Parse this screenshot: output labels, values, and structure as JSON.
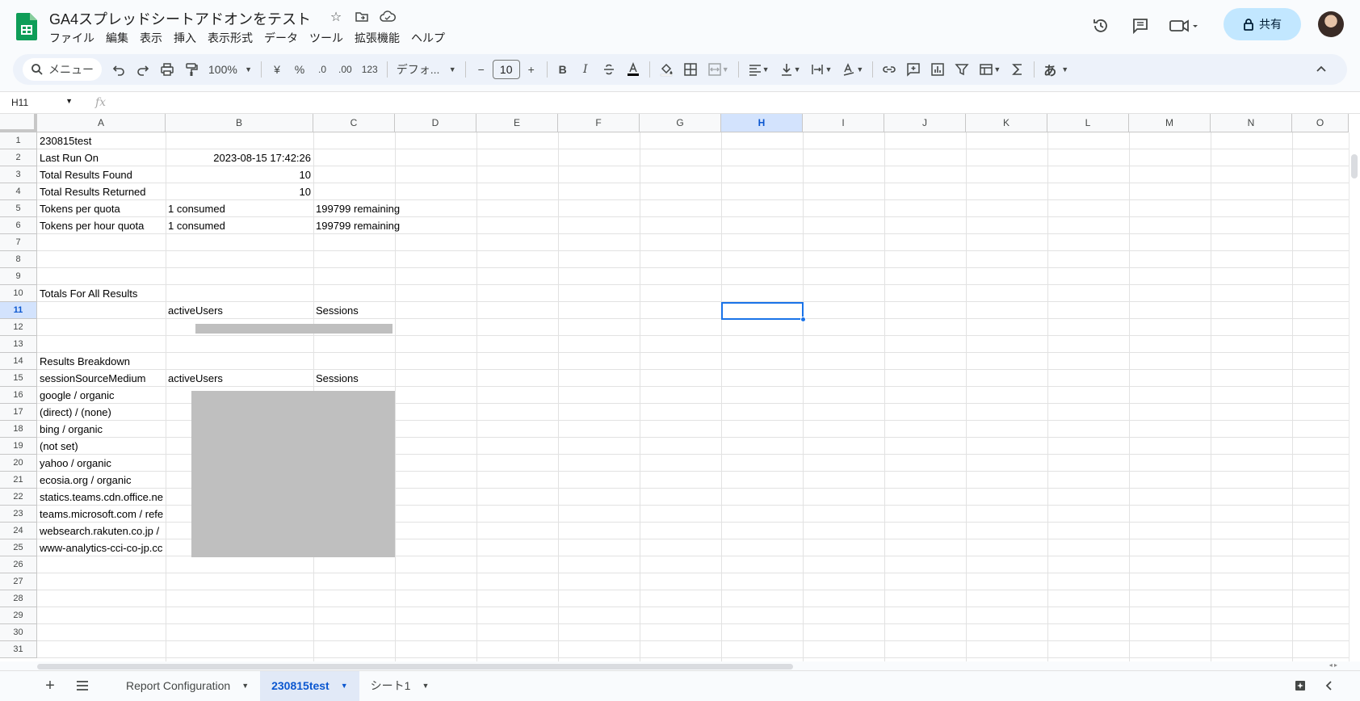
{
  "doc": {
    "title": "GA4スプレッドシートアドオンをテスト",
    "menu": [
      "ファイル",
      "編集",
      "表示",
      "挿入",
      "表示形式",
      "データ",
      "ツール",
      "拡張機能",
      "ヘルプ"
    ],
    "share_label": "共有"
  },
  "toolbar": {
    "search_label": "メニュー",
    "zoom": "100%",
    "currency": "¥",
    "percent": "%",
    "dec_decrease": ".0",
    "dec_increase": ".00",
    "format_123": "123",
    "font": "デフォ...",
    "font_size": "10",
    "bold": "B",
    "italic": "I",
    "input_mode": "あ"
  },
  "formula_bar": {
    "cell_ref": "H11",
    "fx": "fx",
    "value": ""
  },
  "grid": {
    "columns": [
      "A",
      "B",
      "C",
      "D",
      "E",
      "F",
      "G",
      "H",
      "I",
      "J",
      "K",
      "L",
      "M",
      "N",
      "O"
    ],
    "selected_column": "H",
    "selected_row": 11,
    "rows": [
      "1",
      "2",
      "3",
      "4",
      "5",
      "6",
      "7",
      "8",
      "9",
      "10",
      "11",
      "12",
      "13",
      "14",
      "15",
      "16",
      "17",
      "18",
      "19",
      "20",
      "21",
      "22",
      "23",
      "24",
      "25",
      "26",
      "27",
      "28",
      "29",
      "30",
      "31"
    ],
    "cells": {
      "a1": "230815test",
      "a2": "Last Run On",
      "b2": "2023-08-15 17:42:26",
      "a3": "Total Results Found",
      "b3": "10",
      "a4": "Total Results Returned",
      "b4": "10",
      "a5": "Tokens per quota",
      "b5": "1 consumed",
      "c5": "199799 remaining",
      "a6": "Tokens per hour quota",
      "b6": "1 consumed",
      "c6": "199799 remaining",
      "a10": "Totals For All Results",
      "b11": "activeUsers",
      "c11": "Sessions",
      "a14": "Results Breakdown",
      "a15": "sessionSourceMedium",
      "b15": "activeUsers",
      "c15": "Sessions",
      "a16": "google / organic",
      "a17": "(direct) / (none)",
      "a18": "bing / organic",
      "a19": "(not set)",
      "a20": "yahoo / organic",
      "a21": "ecosia.org / organic",
      "a22": "statics.teams.cdn.office.ne",
      "a23": "teams.microsoft.com / refe",
      "a24": "websearch.rakuten.co.jp /",
      "a25": "www-analytics-cci-co-jp.cc"
    }
  },
  "sheets": {
    "tabs": [
      "Report Configuration",
      "230815test",
      "シート1"
    ],
    "active": "230815test"
  },
  "colors": {
    "accent": "#0b57d0",
    "share_bg": "#c2e7ff",
    "selection": "#1a73e8",
    "mask": "#bfbfbf"
  }
}
